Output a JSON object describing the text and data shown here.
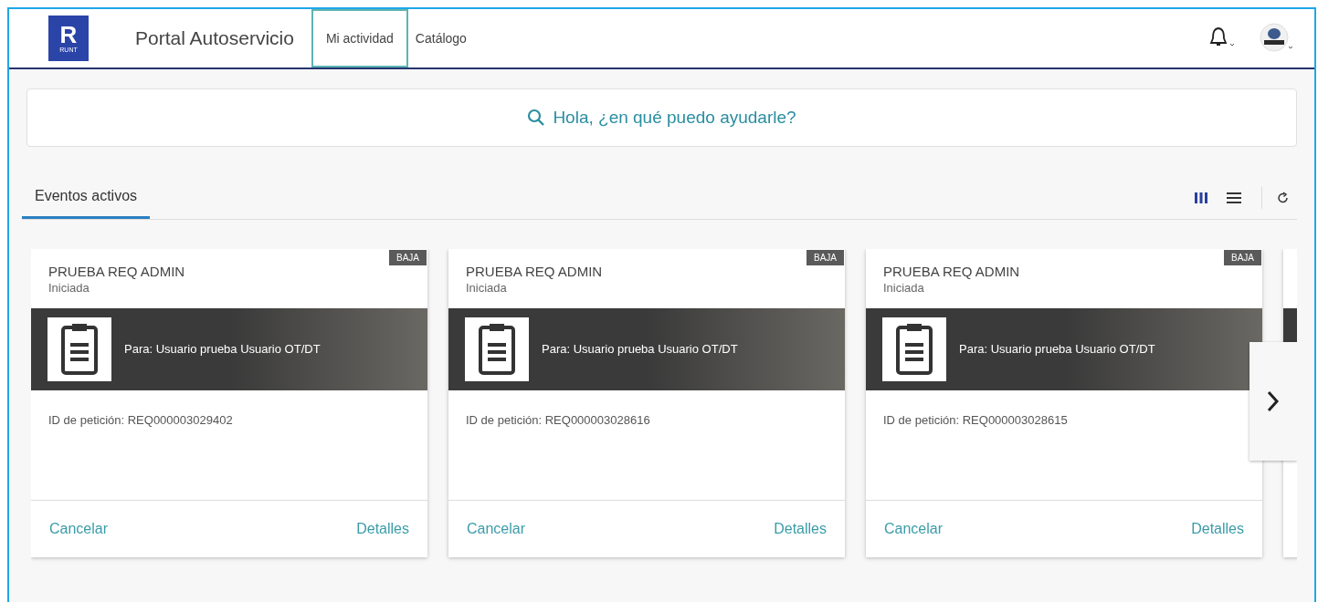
{
  "header": {
    "logo": {
      "letter": "R",
      "caption": "RUNT"
    },
    "title": "Portal Autoservicio",
    "tabs": [
      {
        "label": "Mi actividad",
        "selected": true
      },
      {
        "label": "Catálogo",
        "selected": false
      }
    ]
  },
  "search": {
    "placeholder": "Hola, ¿en qué puedo ayudarle?"
  },
  "section": {
    "tab": {
      "label": "Eventos activos",
      "selected": true
    },
    "views": [
      {
        "kind": "columns",
        "selected": true
      },
      {
        "kind": "list",
        "selected": false
      }
    ]
  },
  "cards": [
    {
      "title": "PRUEBA REQ ADMIN",
      "status": "Iniciada",
      "priority": "BAJA",
      "recipient": "Para: Usuario prueba Usuario OT/DT",
      "request_id": "ID de petición: REQ000003029402",
      "actions": [
        "Cancelar",
        "Detalles"
      ]
    },
    {
      "title": "PRUEBA REQ ADMIN",
      "status": "Iniciada",
      "priority": "BAJA",
      "recipient": "Para: Usuario prueba Usuario OT/DT",
      "request_id": "ID de petición: REQ000003028616",
      "actions": [
        "Cancelar",
        "Detalles"
      ]
    },
    {
      "title": "PRUEBA REQ ADMIN",
      "status": "Iniciada",
      "priority": "BAJA",
      "recipient": "Para: Usuario prueba Usuario OT/DT",
      "request_id": "ID de petición: REQ000003028615",
      "actions": [
        "Cancelar",
        "Detalles"
      ]
    }
  ]
}
